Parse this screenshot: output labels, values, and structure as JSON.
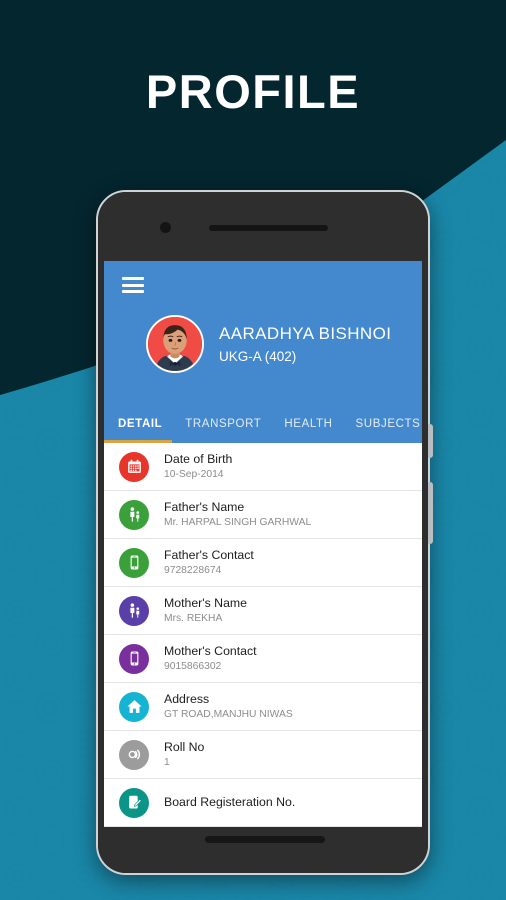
{
  "page": {
    "title": "PROFILE",
    "bg_dark": "#04262f",
    "bg_light": "#1a87a8"
  },
  "app": {
    "header_color": "#4489ce",
    "menu_icon": "hamburger-menu-icon",
    "student": {
      "name": "AARADHYA BISHNOI",
      "class": "UKG-A (402)",
      "avatar_alt": "student-photo"
    },
    "tabs": [
      {
        "label": "DETAIL",
        "active": true
      },
      {
        "label": "TRANSPORT",
        "active": false
      },
      {
        "label": "HEALTH",
        "active": false
      },
      {
        "label": "SUBJECTS",
        "active": false
      }
    ],
    "tab_indicator_color": "#d9a441",
    "details": [
      {
        "label": "Date of Birth",
        "value": "10-Sep-2014",
        "icon": "calendar-icon",
        "color": "#e8352b"
      },
      {
        "label": "Father's Name",
        "value": "Mr. HARPAL SINGH GARHWAL",
        "icon": "parent-child-icon",
        "color": "#3aa03a"
      },
      {
        "label": "Father's Contact",
        "value": "9728228674",
        "icon": "phone-icon",
        "color": "#3aa03a"
      },
      {
        "label": "Mother's Name",
        "value": "Mrs. REKHA",
        "icon": "parent-child-icon",
        "color": "#5b3fa8"
      },
      {
        "label": "Mother's Contact",
        "value": "9015866302",
        "icon": "phone-icon",
        "color": "#7a2f9e"
      },
      {
        "label": "Address",
        "value": "GT ROAD,MANJHU NIWAS",
        "icon": "home-icon",
        "color": "#14b4d2"
      },
      {
        "label": "Roll No",
        "value": "1",
        "icon": "roll-number-icon",
        "color": "#9c9c9c"
      },
      {
        "label": "Board Registeration No.",
        "value": "",
        "icon": "edit-document-icon",
        "color": "#0d9488"
      }
    ]
  }
}
